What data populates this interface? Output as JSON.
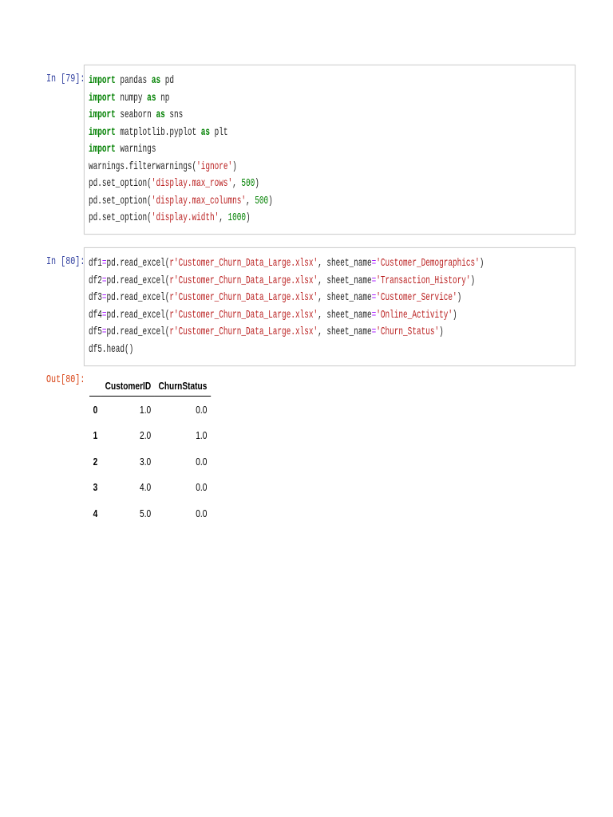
{
  "cells": [
    {
      "prompt": "In [79]:",
      "lines": [
        [
          [
            "kw",
            "import"
          ],
          [
            "p",
            " pandas "
          ],
          [
            "kw",
            "as"
          ],
          [
            "p",
            " pd"
          ]
        ],
        [
          [
            "kw",
            "import"
          ],
          [
            "p",
            " numpy "
          ],
          [
            "kw",
            "as"
          ],
          [
            "p",
            " np"
          ]
        ],
        [
          [
            "kw",
            "import"
          ],
          [
            "p",
            " seaborn "
          ],
          [
            "kw",
            "as"
          ],
          [
            "p",
            " sns"
          ]
        ],
        [
          [
            "kw",
            "import"
          ],
          [
            "p",
            " matplotlib.pyplot "
          ],
          [
            "kw",
            "as"
          ],
          [
            "p",
            " plt"
          ]
        ],
        [
          [
            "kw",
            "import"
          ],
          [
            "p",
            " warnings"
          ]
        ],
        [
          [
            "p",
            "warnings.filterwarnings("
          ],
          [
            "str",
            "'ignore'"
          ],
          [
            "p",
            ")"
          ]
        ],
        [
          [
            "p",
            "pd.set_option("
          ],
          [
            "str",
            "'display.max_rows'"
          ],
          [
            "p",
            ", "
          ],
          [
            "num",
            "500"
          ],
          [
            "p",
            ")"
          ]
        ],
        [
          [
            "p",
            "pd.set_option("
          ],
          [
            "str",
            "'display.max_columns'"
          ],
          [
            "p",
            ", "
          ],
          [
            "num",
            "500"
          ],
          [
            "p",
            ")"
          ]
        ],
        [
          [
            "p",
            "pd.set_option("
          ],
          [
            "str",
            "'display.width'"
          ],
          [
            "p",
            ", "
          ],
          [
            "num",
            "1000"
          ],
          [
            "p",
            ")"
          ]
        ]
      ]
    },
    {
      "prompt": "In [80]:",
      "lines": [
        [
          [
            "p",
            "df1"
          ],
          [
            "op",
            "="
          ],
          [
            "p",
            "pd.read_excel("
          ],
          [
            "str",
            "r'Customer_Churn_Data_Large.xlsx'"
          ],
          [
            "p",
            ", sheet_name"
          ],
          [
            "op",
            "="
          ],
          [
            "str",
            "'Customer_Demographics'"
          ],
          [
            "p",
            ")"
          ]
        ],
        [
          [
            "p",
            "df2"
          ],
          [
            "op",
            "="
          ],
          [
            "p",
            "pd.read_excel("
          ],
          [
            "str",
            "r'Customer_Churn_Data_Large.xlsx'"
          ],
          [
            "p",
            ", sheet_name"
          ],
          [
            "op",
            "="
          ],
          [
            "str",
            "'Transaction_History'"
          ],
          [
            "p",
            ")"
          ]
        ],
        [
          [
            "p",
            "df3"
          ],
          [
            "op",
            "="
          ],
          [
            "p",
            "pd.read_excel("
          ],
          [
            "str",
            "r'Customer_Churn_Data_Large.xlsx'"
          ],
          [
            "p",
            ", sheet_name"
          ],
          [
            "op",
            "="
          ],
          [
            "str",
            "'Customer_Service'"
          ],
          [
            "p",
            ")"
          ]
        ],
        [
          [
            "p",
            "df4"
          ],
          [
            "op",
            "="
          ],
          [
            "p",
            "pd.read_excel("
          ],
          [
            "str",
            "r'Customer_Churn_Data_Large.xlsx'"
          ],
          [
            "p",
            ", sheet_name"
          ],
          [
            "op",
            "="
          ],
          [
            "str",
            "'Online_Activity'"
          ],
          [
            "p",
            ")"
          ]
        ],
        [
          [
            "p",
            "df5"
          ],
          [
            "op",
            "="
          ],
          [
            "p",
            "pd.read_excel("
          ],
          [
            "str",
            "r'Customer_Churn_Data_Large.xlsx'"
          ],
          [
            "p",
            ", sheet_name"
          ],
          [
            "op",
            "="
          ],
          [
            "str",
            "'Churn_Status'"
          ],
          [
            "p",
            ")"
          ]
        ],
        [
          [
            "p",
            "df5.head()"
          ]
        ]
      ]
    }
  ],
  "output": {
    "prompt": "Out[80]:",
    "columns": [
      "",
      "CustomerID",
      "ChurnStatus"
    ],
    "rows": [
      [
        "0",
        "1.0",
        "0.0"
      ],
      [
        "1",
        "2.0",
        "1.0"
      ],
      [
        "2",
        "3.0",
        "0.0"
      ],
      [
        "3",
        "4.0",
        "0.0"
      ],
      [
        "4",
        "5.0",
        "0.0"
      ]
    ]
  }
}
